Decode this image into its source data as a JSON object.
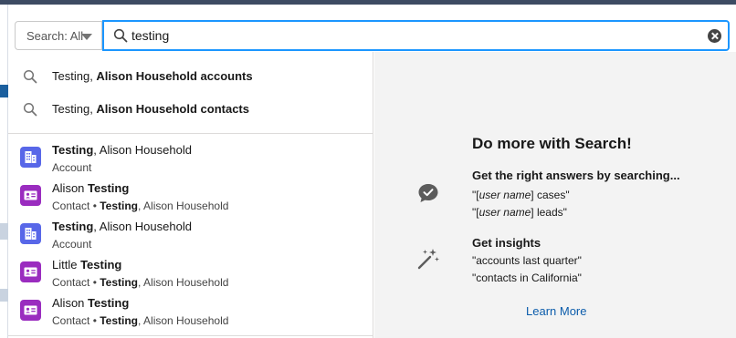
{
  "search": {
    "scope_label": "Search: All",
    "query": "testing"
  },
  "suggestions": [
    {
      "prefix": "Testing, ",
      "bold": "Alison Household accounts"
    },
    {
      "prefix": "Testing, ",
      "bold": "Alison Household contacts"
    }
  ],
  "records": [
    {
      "type": "account",
      "name_bold": "Testing",
      "name_rest": ", Alison Household",
      "sub_type": "Account",
      "sub_bold": "",
      "sub_rest": ""
    },
    {
      "type": "contact",
      "name_pre": "Alison ",
      "name_bold": "Testing",
      "sub_type": "Contact",
      "sub_sep": " • ",
      "sub_bold": "Testing",
      "sub_rest": ", Alison Household"
    },
    {
      "type": "account",
      "name_bold": "Testing",
      "name_rest": ", Alison Household",
      "sub_type": "Account",
      "sub_bold": "",
      "sub_rest": ""
    },
    {
      "type": "contact",
      "name_pre": "Little ",
      "name_bold": "Testing",
      "sub_type": "Contact",
      "sub_sep": " • ",
      "sub_bold": "Testing",
      "sub_rest": ", Alison Household"
    },
    {
      "type": "contact",
      "name_pre": "Alison ",
      "name_bold": "Testing",
      "sub_type": "Contact",
      "sub_sep": " • ",
      "sub_bold": "Testing",
      "sub_rest": ", Alison Household"
    }
  ],
  "help": {
    "title": "Do more with Search!",
    "tips": [
      {
        "icon": "chat-bubble-check-icon",
        "heading": "Get the right answers by searching...",
        "lines": [
          {
            "open": "\"[",
            "italic": "user name",
            "close": "] cases\""
          },
          {
            "open": "\"[",
            "italic": "user name",
            "close": "] leads\""
          }
        ]
      },
      {
        "icon": "magic-wand-icon",
        "heading": "Get insights",
        "lines": [
          {
            "text": "\"accounts last quarter\""
          },
          {
            "text": "\"contacts in California\""
          }
        ]
      }
    ],
    "learn_more": "Learn More"
  },
  "colors": {
    "accent": "#1b96ff",
    "account_icon": "#5867e8",
    "contact_icon": "#9a2cbf",
    "link": "#0b5cab",
    "help_bg": "#f3f3f3"
  }
}
